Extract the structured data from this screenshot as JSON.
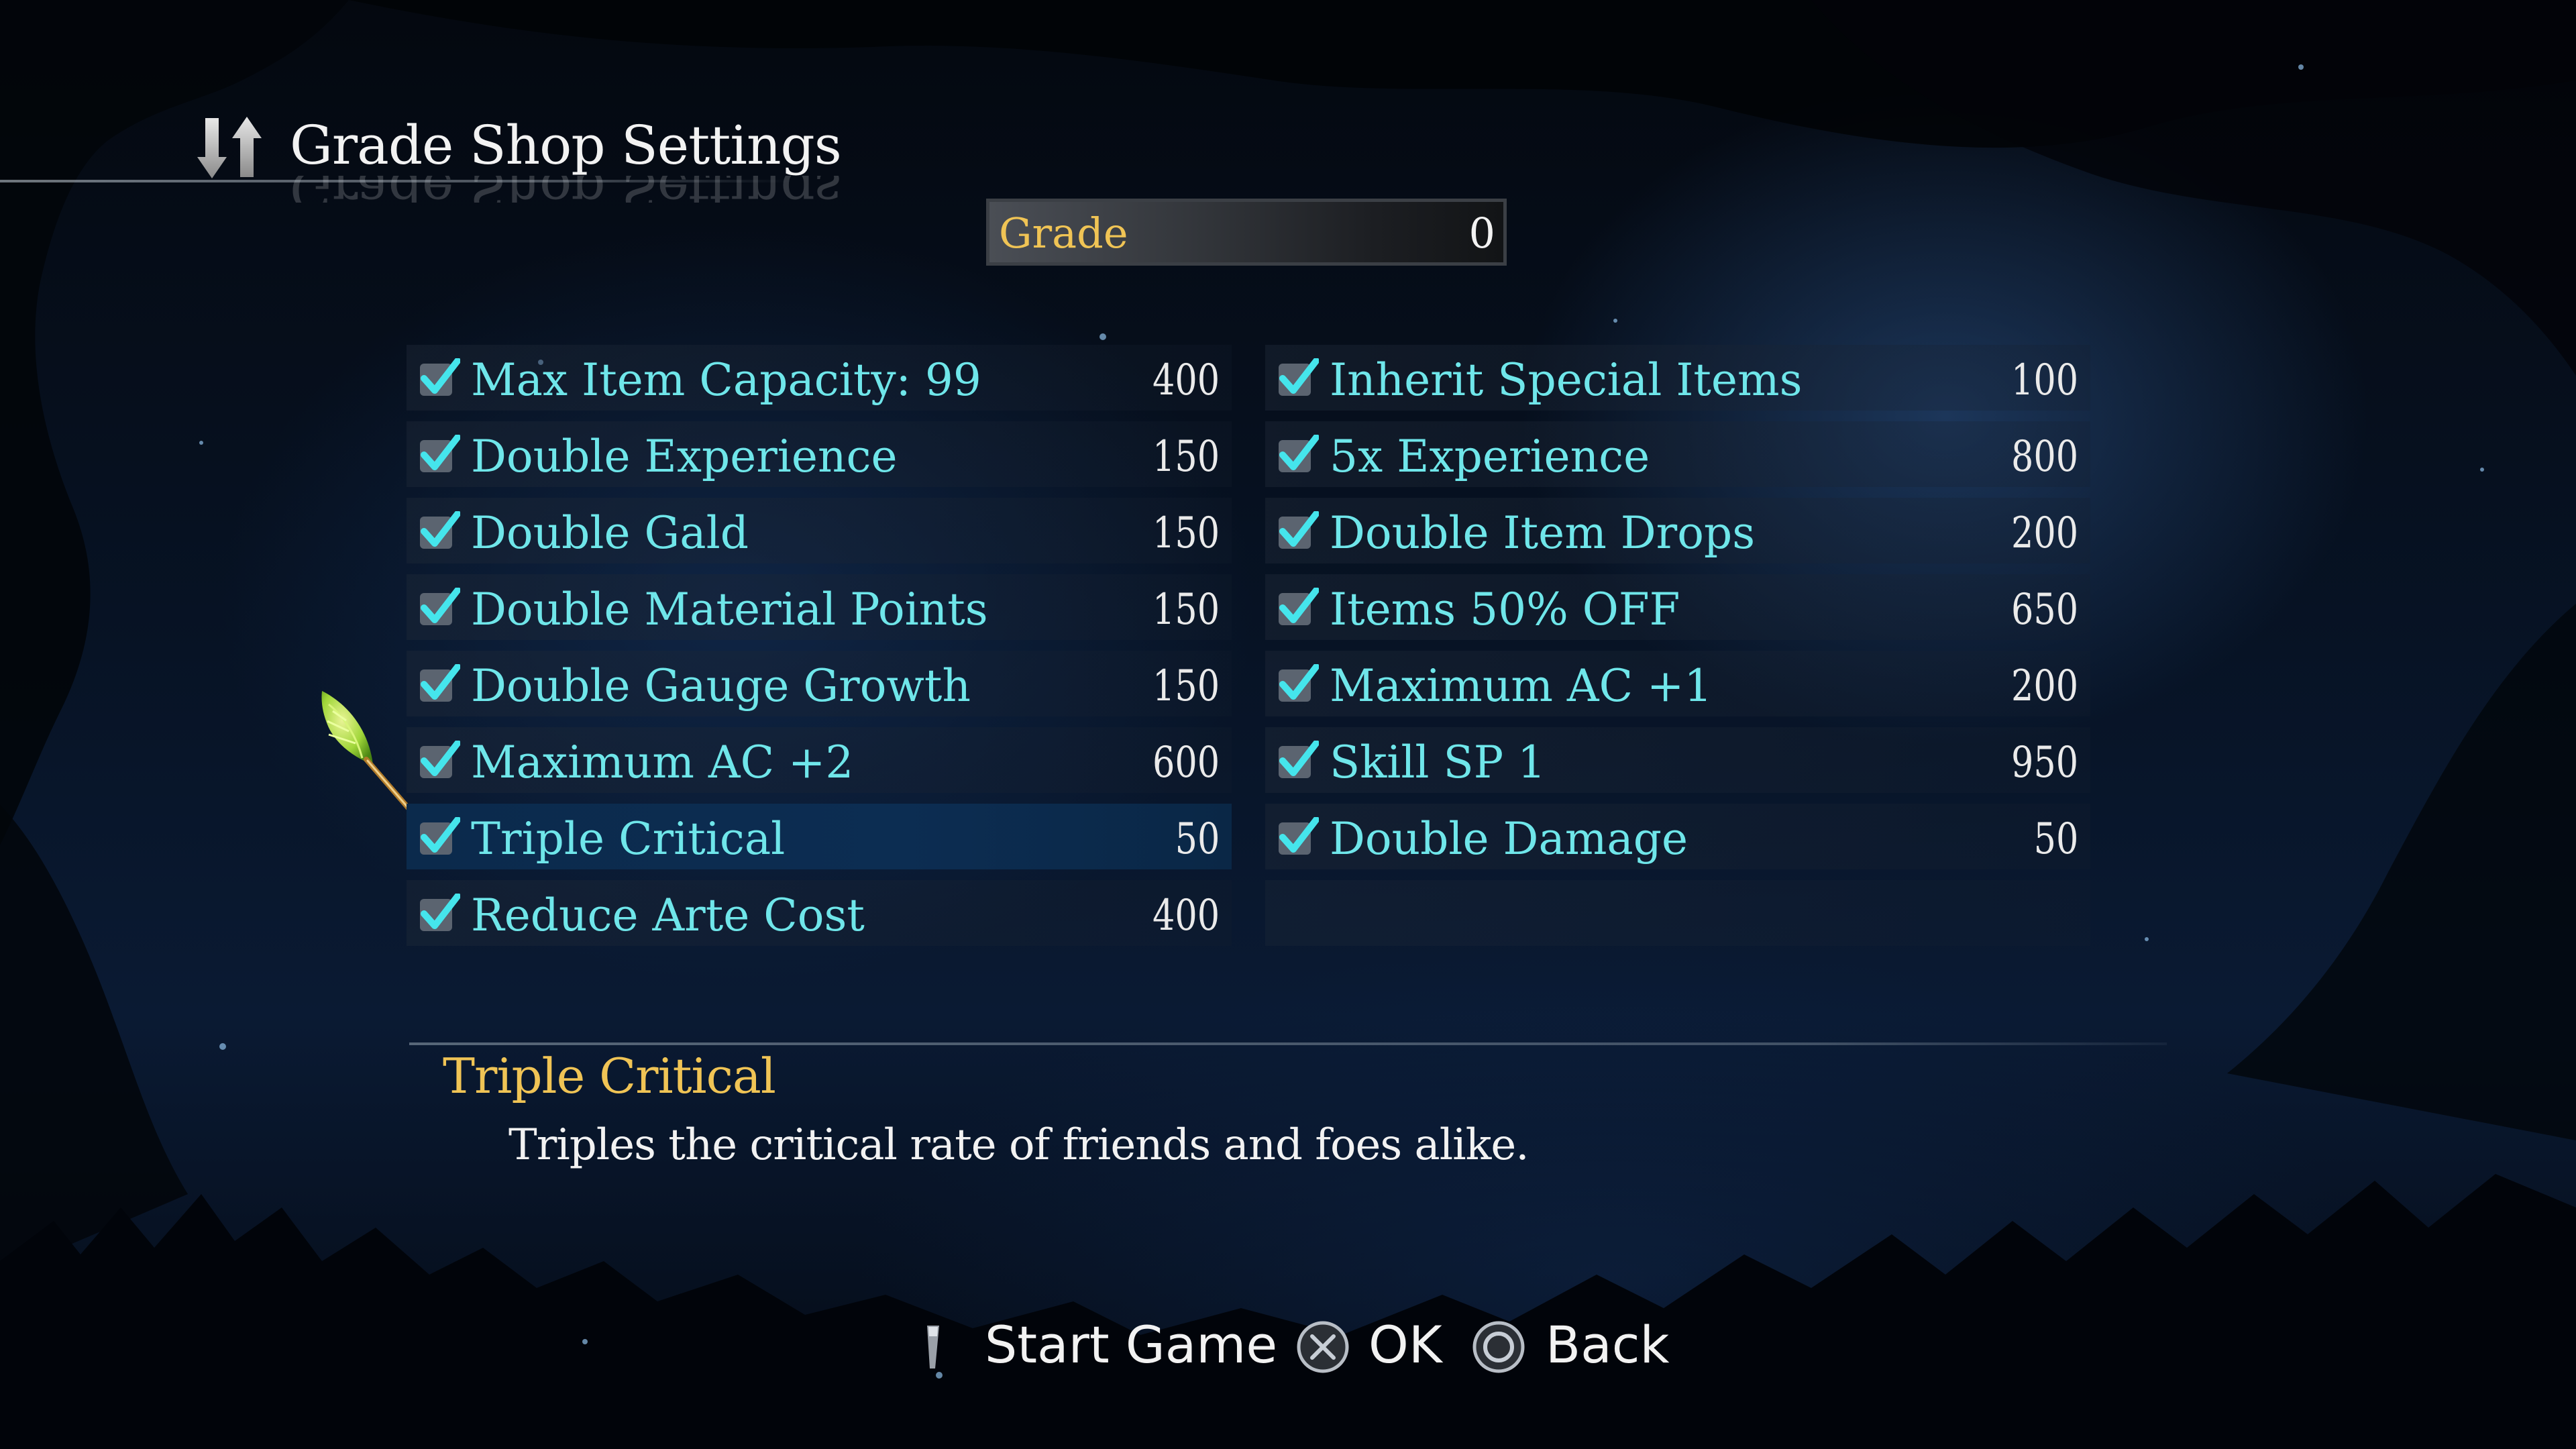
{
  "header": {
    "title": "Grade Shop Settings",
    "title_icon": "sort-arrows-icon"
  },
  "grade": {
    "label": "Grade",
    "value": "0"
  },
  "options_left": [
    {
      "label": "Max Item Capacity: 99",
      "cost": "400",
      "checked": true
    },
    {
      "label": "Double Experience",
      "cost": "150",
      "checked": true
    },
    {
      "label": "Double Gald",
      "cost": "150",
      "checked": true
    },
    {
      "label": "Double Material Points",
      "cost": "150",
      "checked": true
    },
    {
      "label": "Double Gauge Growth",
      "cost": "150",
      "checked": true
    },
    {
      "label": "Maximum AC +2",
      "cost": "600",
      "checked": true
    },
    {
      "label": "Triple Critical",
      "cost": "50",
      "checked": true,
      "selected": true
    },
    {
      "label": "Reduce Arte Cost",
      "cost": "400",
      "checked": true
    }
  ],
  "options_right": [
    {
      "label": "Inherit Special Items",
      "cost": "100",
      "checked": true
    },
    {
      "label": "5x Experience",
      "cost": "800",
      "checked": true
    },
    {
      "label": "Double Item Drops",
      "cost": "200",
      "checked": true
    },
    {
      "label": "Items 50% OFF",
      "cost": "650",
      "checked": true
    },
    {
      "label": "Maximum AC +1",
      "cost": "200",
      "checked": true
    },
    {
      "label": "Skill SP 1",
      "cost": "950",
      "checked": true
    },
    {
      "label": "Double Damage",
      "cost": "50",
      "checked": true
    }
  ],
  "description": {
    "title": "Triple Critical",
    "text": "Triples the critical rate of friends and foes alike."
  },
  "footer": {
    "start_label": "Start Game",
    "start_icon": "touchpad-button-icon",
    "ok_label": "OK",
    "ok_icon": "cross-button-icon",
    "back_label": "Back",
    "back_icon": "circle-button-icon"
  },
  "colors": {
    "item_text": "#6fe6ea",
    "accent_gold": "#f0c455",
    "selected_row": "#0c2d52"
  }
}
